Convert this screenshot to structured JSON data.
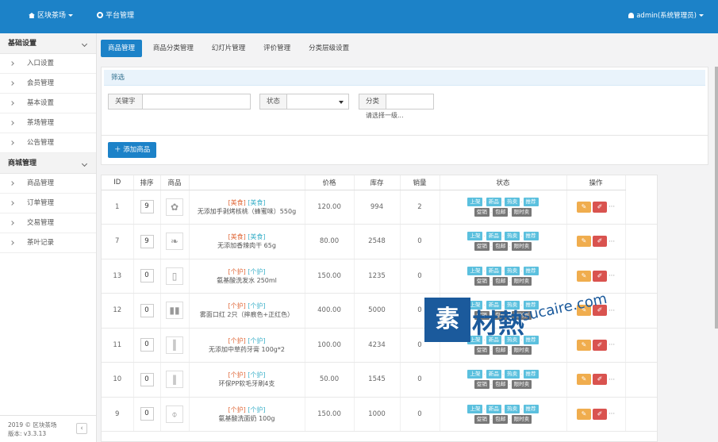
{
  "header": {
    "brand": "区块茶场",
    "module": "平台管理",
    "user": "admin(系统管理员)"
  },
  "sidebar": {
    "sections": [
      {
        "title": "基础设置",
        "items": [
          "入口设置",
          "会员管理",
          "基本设置",
          "茶场管理",
          "公告管理"
        ]
      },
      {
        "title": "商城管理",
        "items": [
          "商品管理",
          "订单管理",
          "交易管理",
          "茶叶记录"
        ]
      }
    ],
    "footer_line1": "2019 © 区块茶场",
    "footer_line2": "版本: v3.3.13"
  },
  "tabs": [
    "商品管理",
    "商品分类管理",
    "幻灯片管理",
    "评价管理",
    "分类层级设置"
  ],
  "filter": {
    "title": "筛选",
    "keyword_label": "关键字",
    "status_label": "状态",
    "category_label": "分类",
    "category_placeholder": "请选择一级..."
  },
  "add_button": "添加商品",
  "table": {
    "headers": [
      "ID",
      "排序",
      "商品",
      "",
      "价格",
      "库存",
      "销量",
      "状态",
      "操作"
    ],
    "badges_row1": [
      "上架",
      "新品",
      "热卖",
      "推荐"
    ],
    "badges_row2": [
      "促销",
      "包邮",
      "限时卖"
    ],
    "rows": [
      {
        "id": "1",
        "sort": "9",
        "cat1": "[美食]",
        "cat2": "[美食]",
        "name": "无添加手剥烤核桃（蜂蜜味）550g",
        "price": "120.00",
        "stock": "994",
        "sales": "2",
        "thumb": "✿"
      },
      {
        "id": "7",
        "sort": "9",
        "cat1": "[美食]",
        "cat2": "[美食]",
        "name": "无添加香辣肉干 65g",
        "price": "80.00",
        "stock": "2548",
        "sales": "0",
        "thumb": "❧"
      },
      {
        "id": "13",
        "sort": "0",
        "cat1": "[个护]",
        "cat2": "[个护]",
        "name": "氨基酸洗发水 250ml",
        "price": "150.00",
        "stock": "1235",
        "sales": "0",
        "thumb": "▯"
      },
      {
        "id": "12",
        "sort": "0",
        "cat1": "[个护]",
        "cat2": "[个护]",
        "name": "雾面口红 2只（摔痕色+正红色）",
        "price": "400.00",
        "stock": "5000",
        "sales": "0",
        "thumb": "▮▮"
      },
      {
        "id": "11",
        "sort": "0",
        "cat1": "[个护]",
        "cat2": "[个护]",
        "name": "无添加中草药牙膏 100g*2",
        "price": "100.00",
        "stock": "4234",
        "sales": "0",
        "thumb": "║"
      },
      {
        "id": "10",
        "sort": "0",
        "cat1": "[个护]",
        "cat2": "[个护]",
        "name": "环保PP软毛牙刷4支",
        "price": "50.00",
        "stock": "1545",
        "sales": "0",
        "thumb": "‖"
      },
      {
        "id": "9",
        "sort": "0",
        "cat1": "[个护]",
        "cat2": "[个护]",
        "name": "氨基酸洗面奶 100g",
        "price": "150.00",
        "stock": "1000",
        "sales": "0",
        "thumb": "⌽"
      }
    ]
  },
  "watermark": {
    "brand": "素材熱",
    "site": "sucaire.com"
  },
  "colors": {
    "primary": "#1c82c8",
    "badge_blue": "#5bc0de",
    "badge_gray": "#777777",
    "edit": "#f0ad4e",
    "delete": "#d9534f"
  }
}
